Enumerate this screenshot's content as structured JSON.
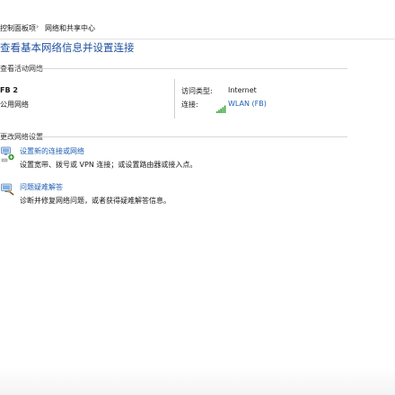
{
  "breadcrumb": {
    "items": [
      "控制面板项",
      "网络和共享中心"
    ],
    "separator": "›"
  },
  "page_title": "查看基本网络信息并设置连接",
  "active_networks": {
    "header": "查看活动网络",
    "network_name": "FB 2",
    "network_type": "公用网络",
    "access_type_label": "访问类型:",
    "access_type_value": "Internet",
    "connections_label": "连接:",
    "connections_value": "WLAN (FB)",
    "connection_icon": "wifi-signal-icon"
  },
  "change_settings": {
    "header": "更改网络设置",
    "tasks": [
      {
        "title": "设置新的连接或网络",
        "description": "设置宽带、拨号或 VPN 连接；或设置路由器或接入点。",
        "icon": "new-connection-icon"
      },
      {
        "title": "问题疑难解答",
        "description": "诊断并修复网络问题，或者获得疑难解答信息。",
        "icon": "troubleshoot-icon"
      }
    ]
  },
  "colors": {
    "title_blue": "#1f4fa0",
    "link_blue": "#1f5fb4",
    "wifi_green": "#3aa53a"
  }
}
